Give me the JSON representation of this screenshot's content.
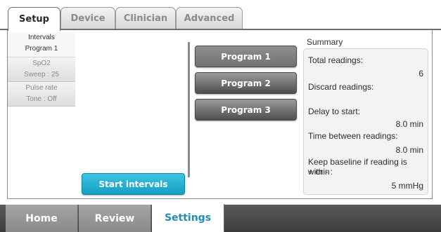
{
  "top_tabs": [
    {
      "label": "Setup",
      "active": true
    },
    {
      "label": "Device",
      "active": false
    },
    {
      "label": "Clinician",
      "active": false
    },
    {
      "label": "Advanced",
      "active": false
    }
  ],
  "sidebar": {
    "intervals": {
      "line1": "Intervals",
      "line2": "Program 1"
    },
    "spo2": {
      "line1": "SpO2",
      "line2": "Sweep : 25"
    },
    "pulse": {
      "line1": "Pulse rate",
      "line2": "Tone : Off"
    }
  },
  "programs": [
    {
      "label": "Program 1",
      "selected": true
    },
    {
      "label": "Program 2",
      "selected": false
    },
    {
      "label": "Program 3",
      "selected": false
    }
  ],
  "start_button": "Start intervals",
  "summary": {
    "title": "Summary",
    "total_readings_label": "Total readings:",
    "total_readings_value": "6",
    "discard_label": "Discard readings:",
    "delay_label": "Delay to start:",
    "delay_value": "8.0 min",
    "between_label": "Time between readings:",
    "between_value": "8.0 min",
    "baseline_label_1": "Keep baseline if reading is within",
    "baseline_label_2": "+ or - :",
    "baseline_value": "5 mmHg"
  },
  "bottom_tabs": [
    {
      "label": "Home",
      "active": false
    },
    {
      "label": "Review",
      "active": false
    },
    {
      "label": "Settings",
      "active": true
    }
  ],
  "colors": {
    "accent": "#1f8fb2",
    "start_button": "#2cb4d6",
    "program_button": "#6e6e6e",
    "bottom_bar": "#4a4a4a"
  }
}
